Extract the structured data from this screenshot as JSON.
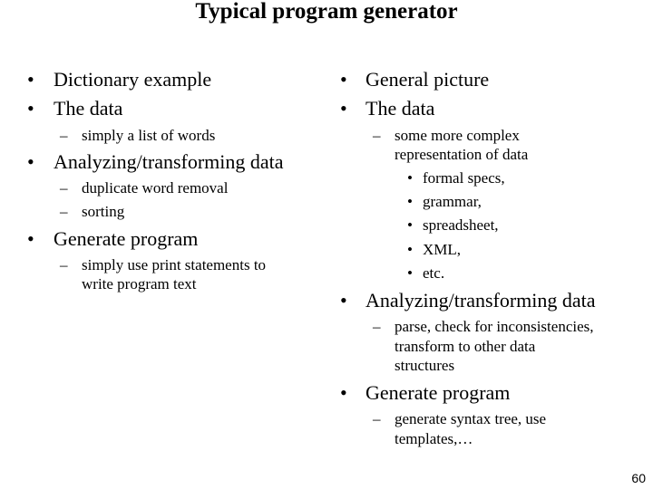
{
  "title": "Typical program generator",
  "left_column": {
    "items": [
      {
        "bullet": "•",
        "text": "Dictionary example"
      },
      {
        "bullet": "•",
        "text": "The data"
      },
      {
        "dash": "–",
        "text": "simply a list of words"
      },
      {
        "bullet": "•",
        "text": "Analyzing/transforming data"
      },
      {
        "dash": "–",
        "text": "duplicate word removal"
      },
      {
        "dash": "–",
        "text": "sorting"
      },
      {
        "bullet": "•",
        "text": "Generate program"
      },
      {
        "dash": "–",
        "text": "simply use print statements to",
        "cont": "write program text"
      }
    ]
  },
  "right_column": {
    "items": [
      {
        "bullet": "•",
        "text": "General picture"
      },
      {
        "bullet": "•",
        "text": "The data"
      },
      {
        "dash": "–",
        "text": "some more complex",
        "cont": "representation of data"
      },
      {
        "bullet": "•",
        "text": "formal specs,"
      },
      {
        "bullet": "•",
        "text": "grammar,"
      },
      {
        "bullet": "•",
        "text": "spreadsheet,"
      },
      {
        "bullet": "•",
        "text": "XML,"
      },
      {
        "bullet": "•",
        "text": "etc."
      },
      {
        "bullet": "•",
        "text": "Analyzing/transforming data"
      },
      {
        "dash": "–",
        "text": "parse, check for inconsistencies,",
        "cont": "transform to other data",
        "cont2": "structures"
      },
      {
        "bullet": "•",
        "text": "Generate program"
      },
      {
        "dash": "–",
        "text": "generate syntax tree, use",
        "cont": "templates,…"
      }
    ]
  },
  "page_number": "60"
}
